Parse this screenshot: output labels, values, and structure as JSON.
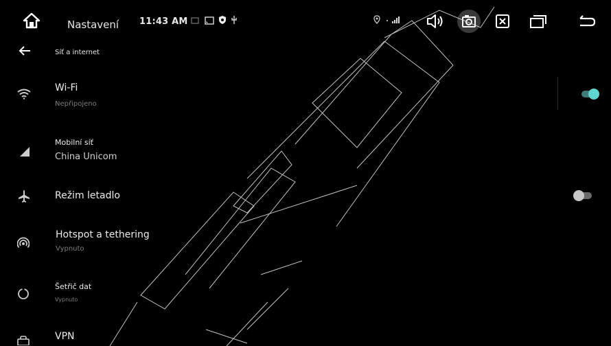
{
  "statusbar": {
    "title": "Nastavení",
    "time": "11:43 AM",
    "icons": [
      "home-icon",
      "cast-icon",
      "screen-mirror-icon",
      "shield-icon",
      "usb-icon",
      "location-icon",
      "signal-icon"
    ],
    "nav": [
      "volume-icon",
      "screenshot-icon",
      "close-app-icon",
      "recent-apps-icon",
      "back-nav-icon"
    ]
  },
  "header": {
    "label": "Síť a internet"
  },
  "rows": [
    {
      "title": "Wi-Fi",
      "subtitle": "Nepřipojeno",
      "icon": "wifi-icon",
      "toggle": true
    },
    {
      "title": "Mobilní síť",
      "subtitle": "China Unicom",
      "icon": "cellular-icon"
    },
    {
      "title": "Režim letadlo",
      "icon": "airplane-icon",
      "toggle": false
    },
    {
      "title": "Hotspot a tethering",
      "subtitle": "Vypnuto",
      "icon": "hotspot-icon"
    },
    {
      "title": "Šetřič dat",
      "subtitle": "Vypnuto",
      "icon": "data-saver-icon"
    },
    {
      "title": "VPN",
      "icon": "vpn-icon"
    }
  ],
  "colors": {
    "accent": "#5fd6d0",
    "background": "#000000",
    "toggle_off": "#c8c8c8"
  }
}
